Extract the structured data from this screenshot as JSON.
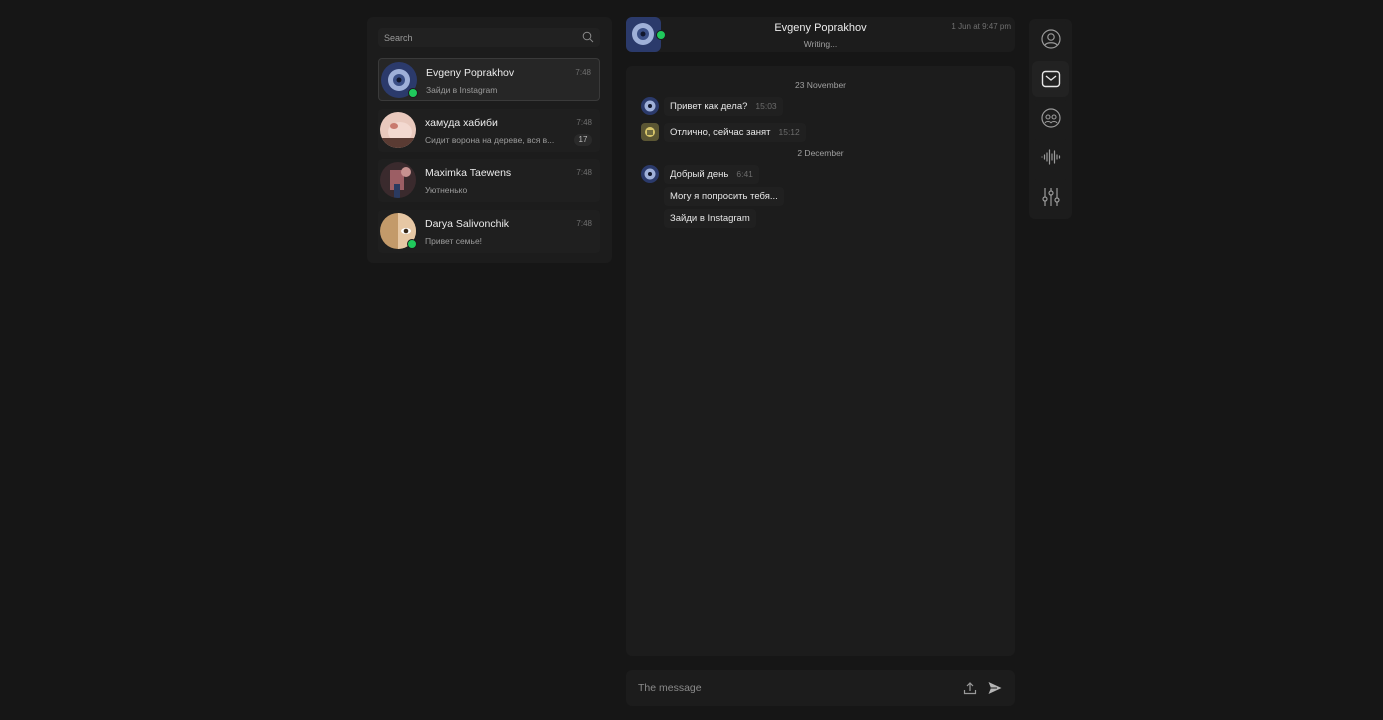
{
  "search": {
    "placeholder": "Search"
  },
  "chats": [
    {
      "name": "Evgeny Poprakhov",
      "time": "7:48",
      "preview": "Зайди в Instagram",
      "online": true,
      "active": true
    },
    {
      "name": "хамуда хабиби",
      "time": "7:48",
      "preview": "Сидит ворона на дереве, вся в...",
      "badge": "17"
    },
    {
      "name": "Maximka Taewens",
      "time": "7:48",
      "preview": "Уютненько"
    },
    {
      "name": "Darya Salivonchik",
      "time": "7:48",
      "preview": "Привет семье!",
      "online": true
    }
  ],
  "header": {
    "name": "Evgeny Poprakhov",
    "status": "Writing...",
    "date": "1 Jun at 9:47 pm"
  },
  "messages": {
    "date1": "23 November",
    "date2": "2 December",
    "items": [
      {
        "text": "Привет как дела?",
        "time": "15:03"
      },
      {
        "text": "Отлично, сейчас занят",
        "time": "15:12"
      },
      {
        "text": "Добрый день",
        "time": "6:41"
      },
      {
        "text": "Могу я попросить тебя..."
      },
      {
        "text": "Зайди в Instagram"
      }
    ]
  },
  "composer": {
    "placeholder": "The message"
  },
  "toolbar": [
    "profile-icon",
    "mail-icon",
    "group-icon",
    "waveform-icon",
    "sliders-icon"
  ],
  "colors": {
    "online": "#20c95c",
    "background": "#161616",
    "panel": "#1c1c1c"
  }
}
